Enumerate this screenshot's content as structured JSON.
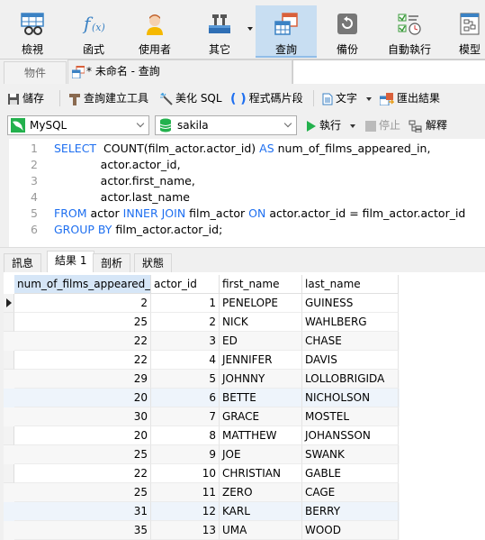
{
  "ribbon": {
    "items": [
      {
        "label": "檢視",
        "icon": "view-table-icon"
      },
      {
        "label": "函式",
        "icon": "function-icon"
      },
      {
        "label": "使用者",
        "icon": "user-icon"
      },
      {
        "label": "其它",
        "icon": "tools-icon"
      },
      {
        "label": "查詢",
        "icon": "query-icon",
        "active": true
      },
      {
        "label": "備份",
        "icon": "backup-icon"
      },
      {
        "label": "自動執行",
        "icon": "automation-icon"
      },
      {
        "label": "模型",
        "icon": "model-icon"
      }
    ]
  },
  "tabs": {
    "objects": "物件",
    "query": "* 未命名 - 查詢"
  },
  "toolbar": {
    "save": "儲存",
    "query_builder": "查詢建立工具",
    "beautify": "美化 SQL",
    "snippet": "程式碼片段",
    "text": "文字",
    "export": "匯出結果",
    "run": "執行",
    "stop": "停止",
    "explain": "解釋"
  },
  "connection": {
    "selected": "MySQL"
  },
  "database": {
    "selected": "sakila"
  },
  "editor": {
    "lines": [
      {
        "n": "1",
        "parts": [
          [
            "kw",
            "SELECT"
          ],
          [
            "t",
            "  COUNT(film_actor.actor_id) "
          ],
          [
            "kw",
            "AS"
          ],
          [
            "t",
            " num_of_films_appeared_in,"
          ]
        ]
      },
      {
        "n": "2",
        "parts": [
          [
            "t",
            "             actor.actor_id,"
          ]
        ]
      },
      {
        "n": "3",
        "parts": [
          [
            "t",
            "             actor.first_name,"
          ]
        ]
      },
      {
        "n": "4",
        "parts": [
          [
            "t",
            "             actor.last_name"
          ]
        ]
      },
      {
        "n": "5",
        "parts": [
          [
            "kw",
            "FROM"
          ],
          [
            "t",
            " actor "
          ],
          [
            "kw",
            "INNER JOIN"
          ],
          [
            "t",
            " film_actor "
          ],
          [
            "kw",
            "ON"
          ],
          [
            "t",
            " actor.actor_id = film_actor.actor_id"
          ]
        ]
      },
      {
        "n": "6",
        "parts": [
          [
            "kw",
            "GROUP BY"
          ],
          [
            "t",
            " film_actor.actor_id;"
          ]
        ]
      }
    ]
  },
  "result_tabs": [
    "訊息",
    "結果 1",
    "剖析",
    "狀態"
  ],
  "grid": {
    "columns": [
      "num_of_films_appeared_in",
      "actor_id",
      "first_name",
      "last_name"
    ],
    "rows": [
      [
        "2",
        "1",
        "PENELOPE",
        "GUINESS"
      ],
      [
        "25",
        "2",
        "NICK",
        "WAHLBERG"
      ],
      [
        "22",
        "3",
        "ED",
        "CHASE"
      ],
      [
        "22",
        "4",
        "JENNIFER",
        "DAVIS"
      ],
      [
        "29",
        "5",
        "JOHNNY",
        "LOLLOBRIGIDA"
      ],
      [
        "20",
        "6",
        "BETTE",
        "NICHOLSON"
      ],
      [
        "30",
        "7",
        "GRACE",
        "MOSTEL"
      ],
      [
        "20",
        "8",
        "MATTHEW",
        "JOHANSSON"
      ],
      [
        "25",
        "9",
        "JOE",
        "SWANK"
      ],
      [
        "22",
        "10",
        "CHRISTIAN",
        "GABLE"
      ],
      [
        "25",
        "11",
        "ZERO",
        "CAGE"
      ],
      [
        "31",
        "12",
        "KARL",
        "BERRY"
      ],
      [
        "35",
        "13",
        "UMA",
        "WOOD"
      ]
    ]
  }
}
